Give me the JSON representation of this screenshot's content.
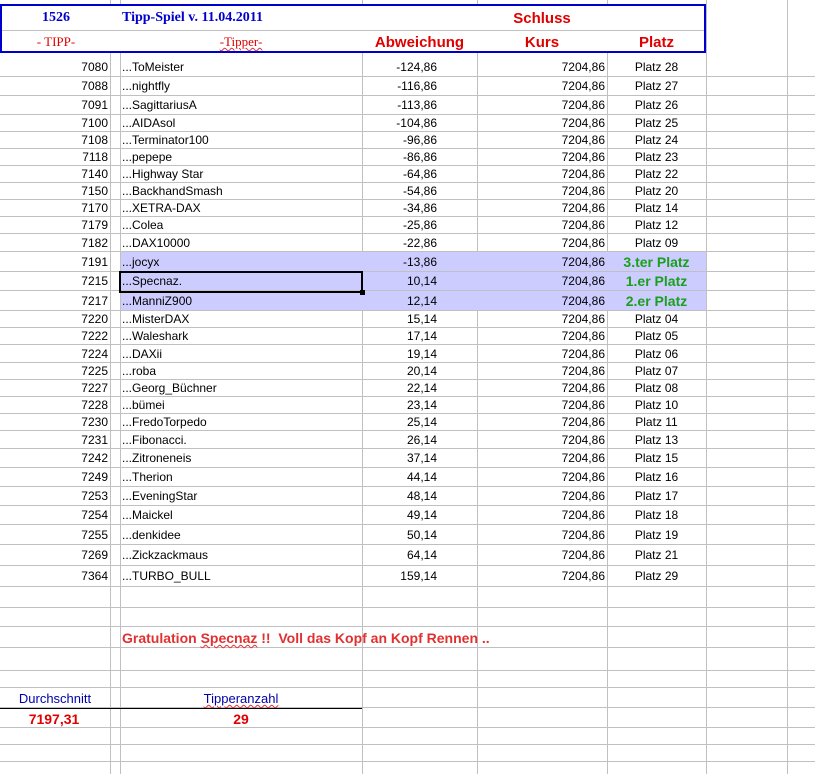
{
  "header": {
    "id": "1526",
    "title": "Tipp-Spiel v. 11.04.2011",
    "schluss": "Schluss",
    "col_tipp": "- TIPP-",
    "col_tipper": "-Tipper-",
    "col_abw": "Abweichung",
    "col_kurs": "Kurs",
    "col_platz": "Platz"
  },
  "colors": {
    "highlight": "#ccccff",
    "winner": "#1aa01a",
    "header_blue": "#0000cc",
    "red": "#e00000"
  },
  "rows": [
    {
      "tipp": "7080",
      "tipper": "...ToMeister",
      "abw": "-124,86",
      "kurs": "7204,86",
      "platz": "Platz 28"
    },
    {
      "tipp": "7088",
      "tipper": "...nightfly",
      "abw": "-116,86",
      "kurs": "7204,86",
      "platz": "Platz 27"
    },
    {
      "tipp": "7091",
      "tipper": "...SagittariusA",
      "abw": "-113,86",
      "kurs": "7204,86",
      "platz": "Platz 26"
    },
    {
      "tipp": "7100",
      "tipper": "...AIDAsol",
      "abw": "-104,86",
      "kurs": "7204,86",
      "platz": "Platz 25"
    },
    {
      "tipp": "7108",
      "tipper": "...Terminator100",
      "abw": "-96,86",
      "kurs": "7204,86",
      "platz": "Platz 24"
    },
    {
      "tipp": "7118",
      "tipper": "...pepepe",
      "abw": "-86,86",
      "kurs": "7204,86",
      "platz": "Platz 23"
    },
    {
      "tipp": "7140",
      "tipper": "...Highway Star",
      "abw": "-64,86",
      "kurs": "7204,86",
      "platz": "Platz 22"
    },
    {
      "tipp": "7150",
      "tipper": "...BackhandSmash",
      "abw": "-54,86",
      "kurs": "7204,86",
      "platz": "Platz 20"
    },
    {
      "tipp": "7170",
      "tipper": "...XETRA-DAX",
      "abw": "-34,86",
      "kurs": "7204,86",
      "platz": "Platz 14"
    },
    {
      "tipp": "7179",
      "tipper": "...Colea",
      "abw": "-25,86",
      "kurs": "7204,86",
      "platz": "Platz 12"
    },
    {
      "tipp": "7182",
      "tipper": "...DAX10000",
      "abw": "-22,86",
      "kurs": "7204,86",
      "platz": "Platz 09"
    },
    {
      "tipp": "7191",
      "tipper": "...jocyx",
      "abw": "-13,86",
      "kurs": "7204,86",
      "platz": "3.ter Platz",
      "win": true
    },
    {
      "tipp": "7215",
      "tipper": "...Specnaz.",
      "abw": "10,14",
      "kurs": "7204,86",
      "platz": "1.er Platz",
      "win": true
    },
    {
      "tipp": "7217",
      "tipper": "...ManniZ900",
      "abw": "12,14",
      "kurs": "7204,86",
      "platz": "2.er Platz",
      "win": true
    },
    {
      "tipp": "7220",
      "tipper": "...MisterDAX",
      "abw": "15,14",
      "kurs": "7204,86",
      "platz": "Platz 04"
    },
    {
      "tipp": "7222",
      "tipper": "...Waleshark",
      "abw": "17,14",
      "kurs": "7204,86",
      "platz": "Platz 05"
    },
    {
      "tipp": "7224",
      "tipper": "...DAXii",
      "abw": "19,14",
      "kurs": "7204,86",
      "platz": "Platz 06"
    },
    {
      "tipp": "7225",
      "tipper": "...roba",
      "abw": "20,14",
      "kurs": "7204,86",
      "platz": "Platz 07"
    },
    {
      "tipp": "7227",
      "tipper": "...Georg_Büchner",
      "abw": "22,14",
      "kurs": "7204,86",
      "platz": "Platz 08"
    },
    {
      "tipp": "7228",
      "tipper": "...bümei",
      "abw": "23,14",
      "kurs": "7204,86",
      "platz": "Platz 10"
    },
    {
      "tipp": "7230",
      "tipper": "...FredoTorpedo",
      "abw": "25,14",
      "kurs": "7204,86",
      "platz": "Platz 11"
    },
    {
      "tipp": "7231",
      "tipper": "...Fibonacci.",
      "abw": "26,14",
      "kurs": "7204,86",
      "platz": "Platz 13"
    },
    {
      "tipp": "7242",
      "tipper": "...Zitroneneis",
      "abw": "37,14",
      "kurs": "7204,86",
      "platz": "Platz 15"
    },
    {
      "tipp": "7249",
      "tipper": "...Therion",
      "abw": "44,14",
      "kurs": "7204,86",
      "platz": "Platz 16"
    },
    {
      "tipp": "7253",
      "tipper": "...EveningStar",
      "abw": "48,14",
      "kurs": "7204,86",
      "platz": "Platz 17"
    },
    {
      "tipp": "7254",
      "tipper": "...Maickel",
      "abw": "49,14",
      "kurs": "7204,86",
      "platz": "Platz 18"
    },
    {
      "tipp": "7255",
      "tipper": "...denkidee",
      "abw": "50,14",
      "kurs": "7204,86",
      "platz": "Platz 19"
    },
    {
      "tipp": "7269",
      "tipper": "...Zickzackmaus",
      "abw": "64,14",
      "kurs": "7204,86",
      "platz": "Platz 21"
    },
    {
      "tipp": "7364",
      "tipper": "...TURBO_BULL",
      "abw": "159,14",
      "kurs": "7204,86",
      "platz": "Platz 29"
    }
  ],
  "footer": {
    "gratulation_pre": "Gratulation ",
    "gratulation_name": "Specnaz",
    "gratulation_post": " !!  Voll das Kopf an Kopf Rennen ..",
    "avg_label": "Durchschnitt",
    "avg_value": "7197,31",
    "count_label": "Tipperanzahl",
    "count_value": "29"
  }
}
